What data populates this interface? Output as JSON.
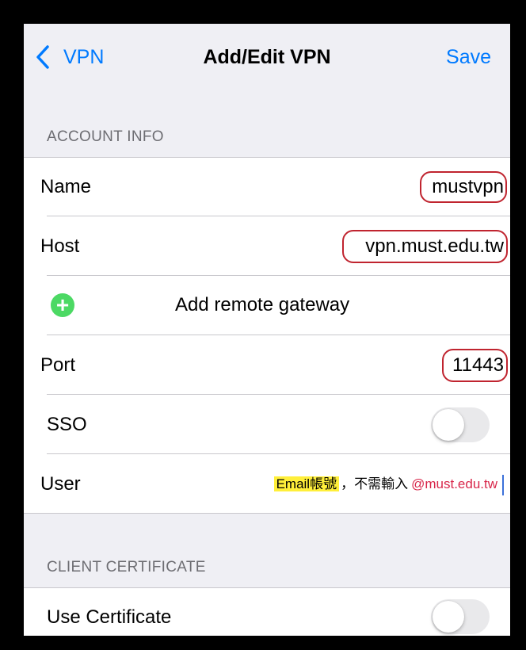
{
  "nav": {
    "back_label": "VPN",
    "title": "Add/Edit VPN",
    "save_label": "Save"
  },
  "account_info": {
    "header": "ACCOUNT INFO",
    "name_label": "Name",
    "name_value": "mustvpn",
    "host_label": "Host",
    "host_value": "vpn.must.edu.tw",
    "add_gateway_label": "Add remote gateway",
    "port_label": "Port",
    "port_value": "11443",
    "sso_label": "SSO",
    "sso_on": false,
    "user_label": "User",
    "user_hint_highlight": "Email帳號",
    "user_hint_middle": "，不需輸入",
    "user_hint_domain": "@must.edu.tw"
  },
  "client_certificate": {
    "header": "CLIENT CERTIFICATE",
    "use_certificate_label": "Use Certificate",
    "use_certificate_on": false
  },
  "colors": {
    "accent": "#007aff",
    "annotation": "#c0242f",
    "highlight": "#ffef3a",
    "add_icon": "#4cd964"
  }
}
